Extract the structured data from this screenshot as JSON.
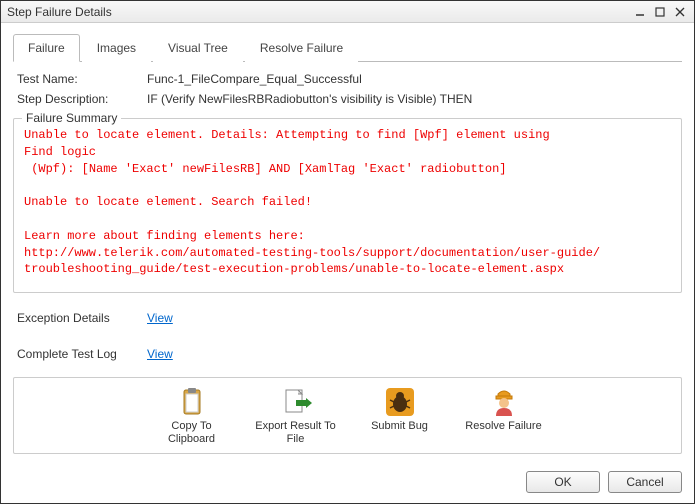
{
  "window": {
    "title": "Step Failure Details"
  },
  "tabs": {
    "failure": "Failure",
    "images": "Images",
    "visual_tree": "Visual Tree",
    "resolve_failure": "Resolve Failure"
  },
  "info": {
    "test_name_label": "Test Name:",
    "test_name_value": "Func-1_FileCompare_Equal_Successful",
    "step_desc_label": "Step Description:",
    "step_desc_value": "IF (Verify NewFilesRBRadiobutton's visibility is Visible) THEN"
  },
  "failure": {
    "legend": "Failure Summary",
    "text": "Unable to locate element. Details: Attempting to find [Wpf] element using \nFind logic \n (Wpf): [Name 'Exact' newFilesRB] AND [XamlTag 'Exact' radiobutton]\n\nUnable to locate element. Search failed!\n\nLearn more about finding elements here:\nhttp://www.telerik.com/automated-testing-tools/support/documentation/user-guide/\ntroubleshooting_guide/test-execution-problems/unable-to-locate-element.aspx"
  },
  "links": {
    "exception_label": "Exception Details",
    "exception_link": "View",
    "log_label": "Complete Test Log",
    "log_link": "View"
  },
  "actions": {
    "copy": "Copy To Clipboard",
    "export": "Export Result To File",
    "submit": "Submit Bug",
    "resolve": "Resolve Failure"
  },
  "footer": {
    "ok": "OK",
    "cancel": "Cancel"
  }
}
